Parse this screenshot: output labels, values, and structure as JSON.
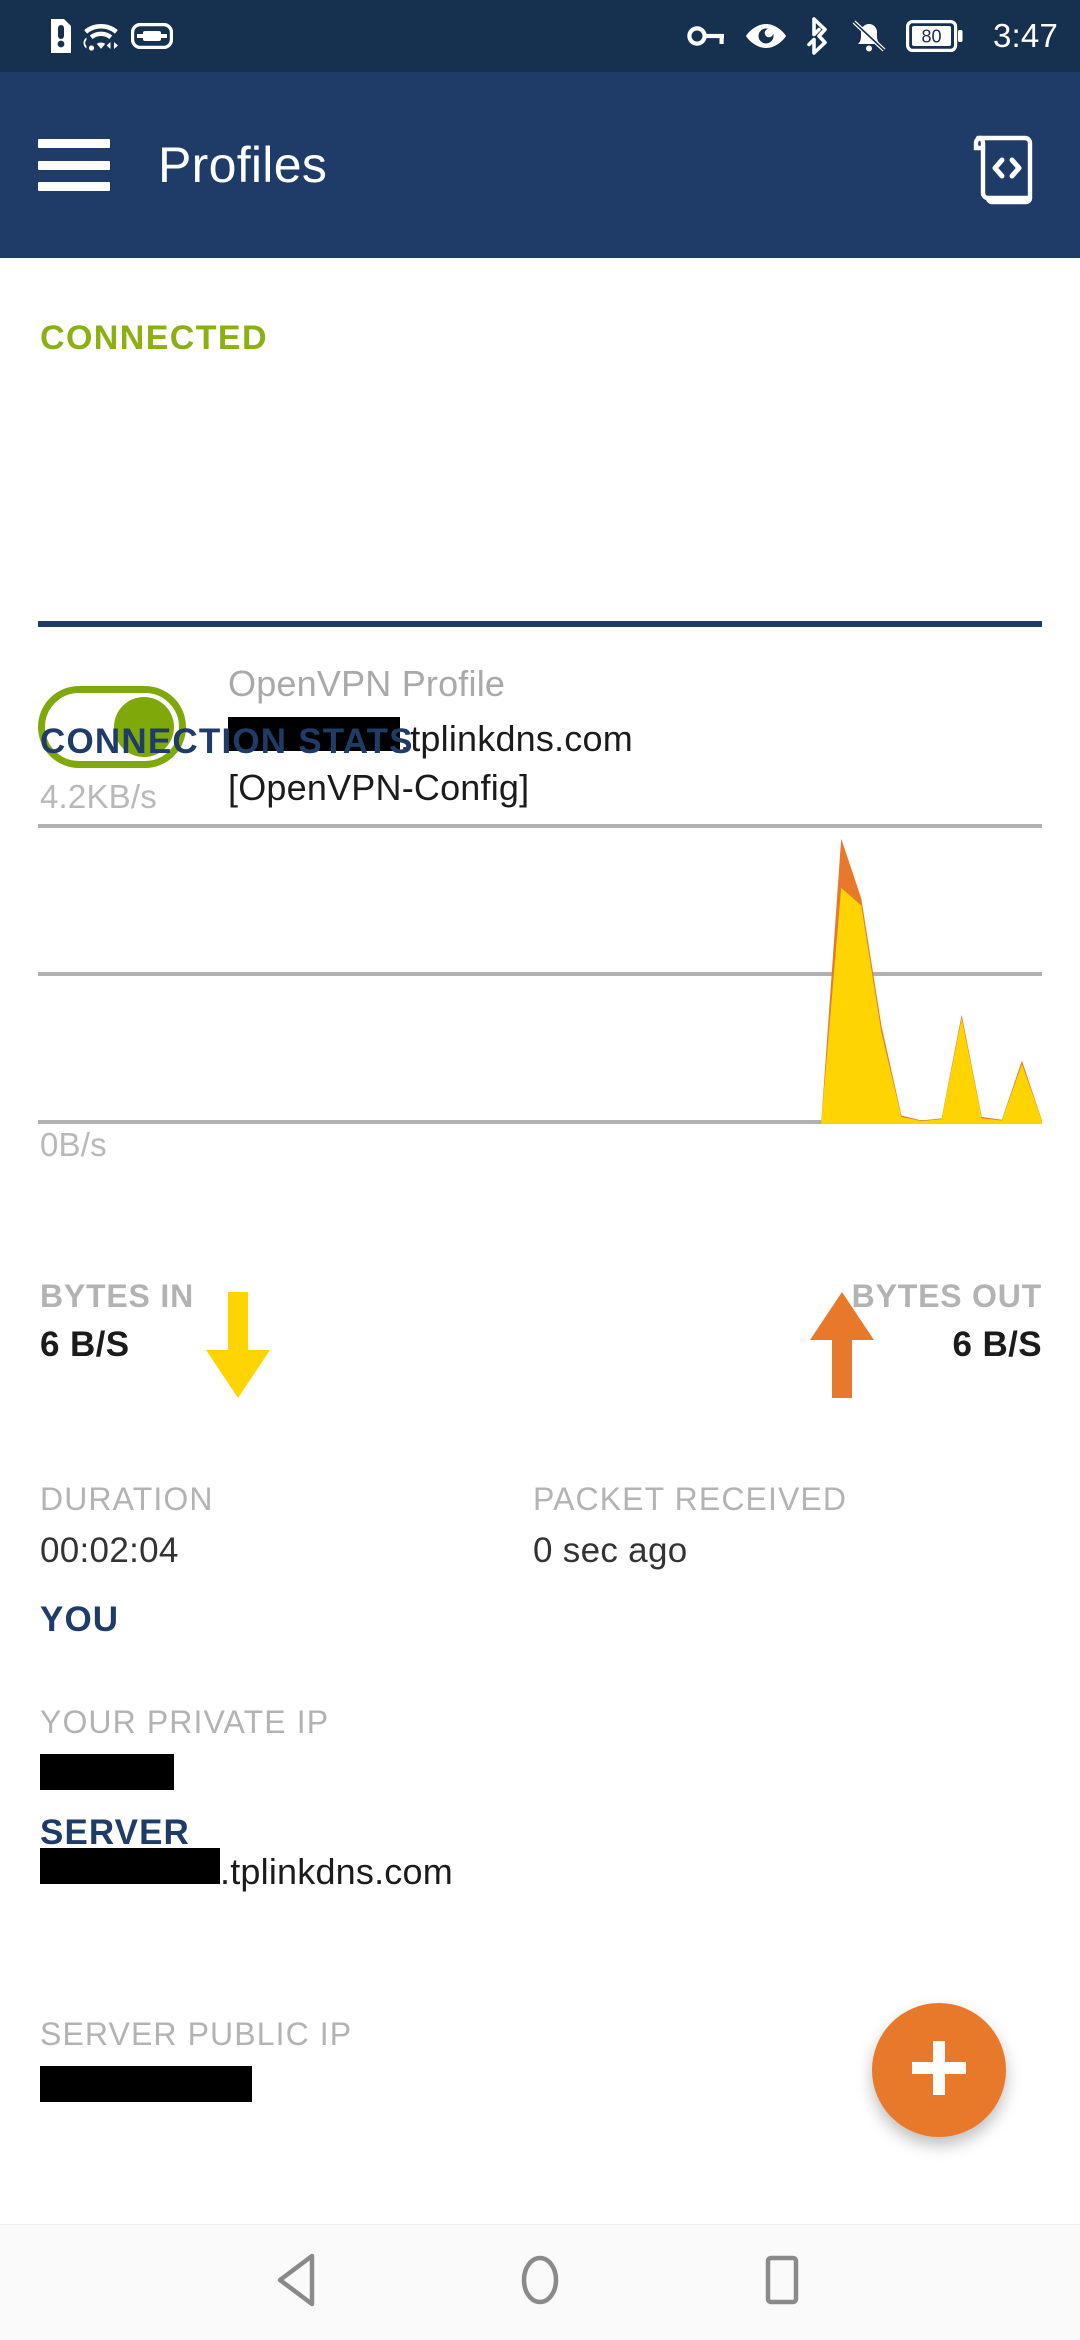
{
  "status_bar": {
    "left_icons": [
      "sim-alert-icon",
      "wifi-hotspot-icon",
      "vpn-key-icon"
    ],
    "right_icons": [
      "key-icon",
      "eye-icon",
      "bluetooth-icon",
      "bell-off-icon"
    ],
    "battery_level": "80",
    "time": "3:47"
  },
  "app_bar": {
    "menu_icon": "hamburger-menu-icon",
    "title": "Profiles",
    "action_icon": "log-scroll-icon"
  },
  "connection": {
    "status_label": "CONNECTED",
    "status_color": "#8cb011",
    "toggle_on": true,
    "profile_kind": "OpenVPN Profile",
    "profile_host_redacted": "",
    "profile_host_suffix": ".tplinkdns.com",
    "profile_config": "[OpenVPN-Config]"
  },
  "stats": {
    "title": "CONNECTION STATS",
    "axis_top": "4.2KB/s",
    "axis_bottom": "0B/s",
    "bytes_in_label": "BYTES IN",
    "bytes_in_value": "6 B/S",
    "bytes_in_color": "#ffd400",
    "bytes_out_label": "BYTES OUT",
    "bytes_out_value": "6 B/S",
    "bytes_out_color": "#e8792a",
    "duration_label": "DURATION",
    "duration_value": "00:02:04",
    "packet_label": "PACKET RECEIVED",
    "packet_value": "0 sec ago"
  },
  "chart_data": {
    "type": "area",
    "title": "CONNECTION STATS",
    "xlabel": "",
    "ylabel": "",
    "ylim": [
      0,
      4.2
    ],
    "y_unit": "KB/s",
    "ytick_labels": [
      "4.2KB/s",
      "0B/s"
    ],
    "gridlines": 3,
    "grid": true,
    "legend": "inline-arrows",
    "x": [
      0,
      2,
      4,
      6,
      8,
      10,
      12,
      14,
      16,
      18,
      20,
      22,
      24,
      26,
      28,
      30,
      32,
      34,
      36,
      38,
      40,
      42,
      44,
      46,
      48,
      50,
      52,
      54,
      56,
      58,
      60,
      62,
      64,
      66,
      68,
      70,
      72,
      74,
      76,
      78,
      80,
      82,
      84,
      86,
      88,
      90,
      92,
      94,
      96,
      98,
      100
    ],
    "series": [
      {
        "name": "BYTES OUT",
        "color": "#e8792a",
        "values": [
          0,
          0,
          0,
          0,
          0,
          0,
          0,
          0,
          0,
          0,
          0,
          0,
          0,
          0,
          0,
          0,
          0,
          0,
          0,
          0,
          0,
          0,
          0,
          0,
          0,
          0,
          0,
          0,
          0,
          0,
          0,
          0,
          0,
          0,
          0,
          0,
          0,
          0,
          0,
          0,
          4.05,
          3.2,
          1.4,
          0.12,
          0.05,
          0.08,
          1.55,
          0.1,
          0.06,
          0.9,
          0.05
        ]
      },
      {
        "name": "BYTES IN",
        "color": "#ffd400",
        "values": [
          0,
          0,
          0,
          0,
          0,
          0,
          0,
          0,
          0,
          0,
          0,
          0,
          0,
          0,
          0,
          0,
          0,
          0,
          0,
          0,
          0,
          0,
          0,
          0,
          0,
          0,
          0,
          0,
          0,
          0,
          0,
          0,
          0,
          0,
          0,
          0,
          0,
          0,
          0,
          0,
          3.35,
          3.1,
          1.3,
          0.1,
          0.04,
          0.07,
          1.5,
          0.08,
          0.05,
          0.85,
          0.04
        ]
      }
    ]
  },
  "you": {
    "section": "YOU",
    "private_ip_label": "YOUR PRIVATE IP",
    "private_ip_value": ""
  },
  "server": {
    "section": "SERVER",
    "host_redacted": "",
    "host_suffix": ".tplinkdns.com",
    "public_ip_label": "SERVER PUBLIC IP",
    "public_ip_value": ""
  },
  "fab": {
    "icon": "plus-icon",
    "color": "#e8792a"
  },
  "nav_bar": {
    "back": "back-triangle-icon",
    "home": "home-circle-icon",
    "recents": "recents-square-icon"
  }
}
